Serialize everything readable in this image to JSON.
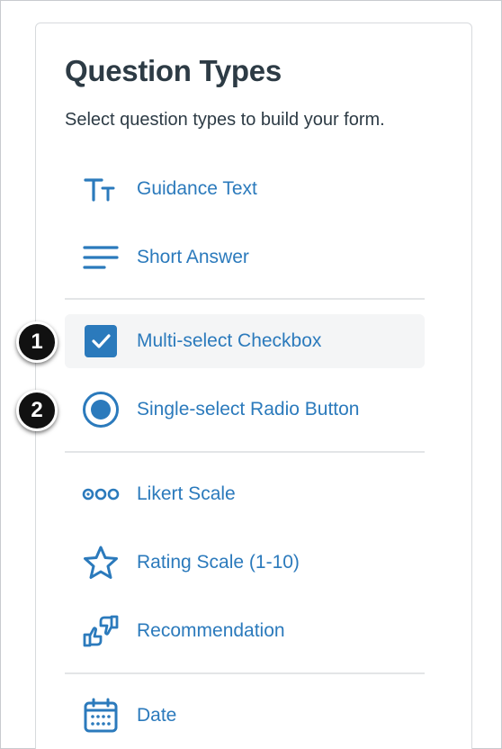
{
  "heading": "Question Types",
  "subheading": "Select question types to build your form.",
  "items": [
    {
      "label": "Guidance Text",
      "icon": "text-size-icon"
    },
    {
      "label": "Short Answer",
      "icon": "lines-icon"
    },
    {
      "label": "Multi-select Checkbox",
      "icon": "checkbox-icon"
    },
    {
      "label": "Single-select Radio Button",
      "icon": "radio-button-icon"
    },
    {
      "label": "Likert Scale",
      "icon": "three-circles-icon"
    },
    {
      "label": "Rating Scale (1-10)",
      "icon": "star-icon"
    },
    {
      "label": "Recommendation",
      "icon": "thumbs-icon"
    },
    {
      "label": "Date",
      "icon": "calendar-icon"
    }
  ],
  "callouts": [
    "1",
    "2"
  ],
  "colors": {
    "accent": "#2b7abc",
    "text": "#2d3b45",
    "selected_bg": "#f4f5f6"
  }
}
